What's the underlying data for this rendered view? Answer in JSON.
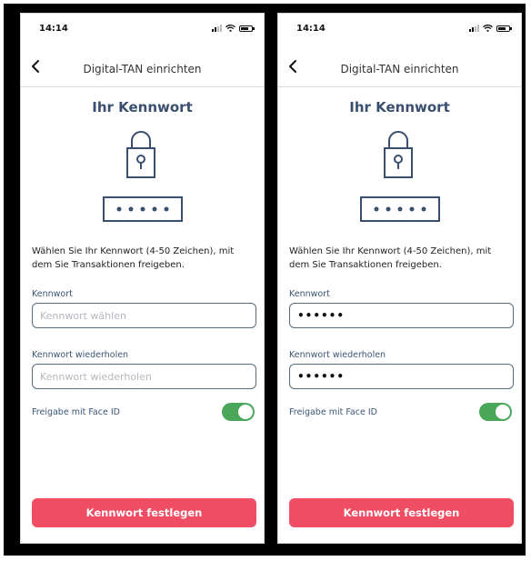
{
  "colors": {
    "accent": "#ee4d64",
    "title": "#3a4f6f",
    "label": "#3a5675",
    "toggle_on": "#4aa75a"
  },
  "screens": [
    {
      "status_time": "14:14",
      "nav_title": "Digital-TAN einrichten",
      "back_icon": "chevron-left-icon",
      "page_title": "Ihr Kennwort",
      "illustration": "lock-password-icon",
      "description": "Wählen Sie Ihr Kennwort (4-50 Zeichen), mit dem Sie Transaktionen freigeben.",
      "password_label": "Kennwort",
      "password_placeholder": "Kennwort wählen",
      "password_value": "",
      "repeat_label": "Kennwort wiederholen",
      "repeat_placeholder": "Kennwort wiederholen",
      "repeat_value": "",
      "faceid_label": "Freigabe mit Face ID",
      "faceid_enabled": true,
      "submit_label": "Kennwort festlegen"
    },
    {
      "status_time": "14:14",
      "nav_title": "Digital-TAN einrichten",
      "back_icon": "chevron-left-icon",
      "page_title": "Ihr Kennwort",
      "illustration": "lock-password-icon",
      "description": "Wählen Sie Ihr Kennwort (4-50 Zeichen), mit dem Sie Transaktionen freigeben.",
      "password_label": "Kennwort",
      "password_placeholder": "",
      "password_value": "••••••",
      "repeat_label": "Kennwort wiederholen",
      "repeat_placeholder": "",
      "repeat_value": "••••••",
      "faceid_label": "Freigabe mit Face ID",
      "faceid_enabled": true,
      "submit_label": "Kennwort festlegen"
    }
  ]
}
